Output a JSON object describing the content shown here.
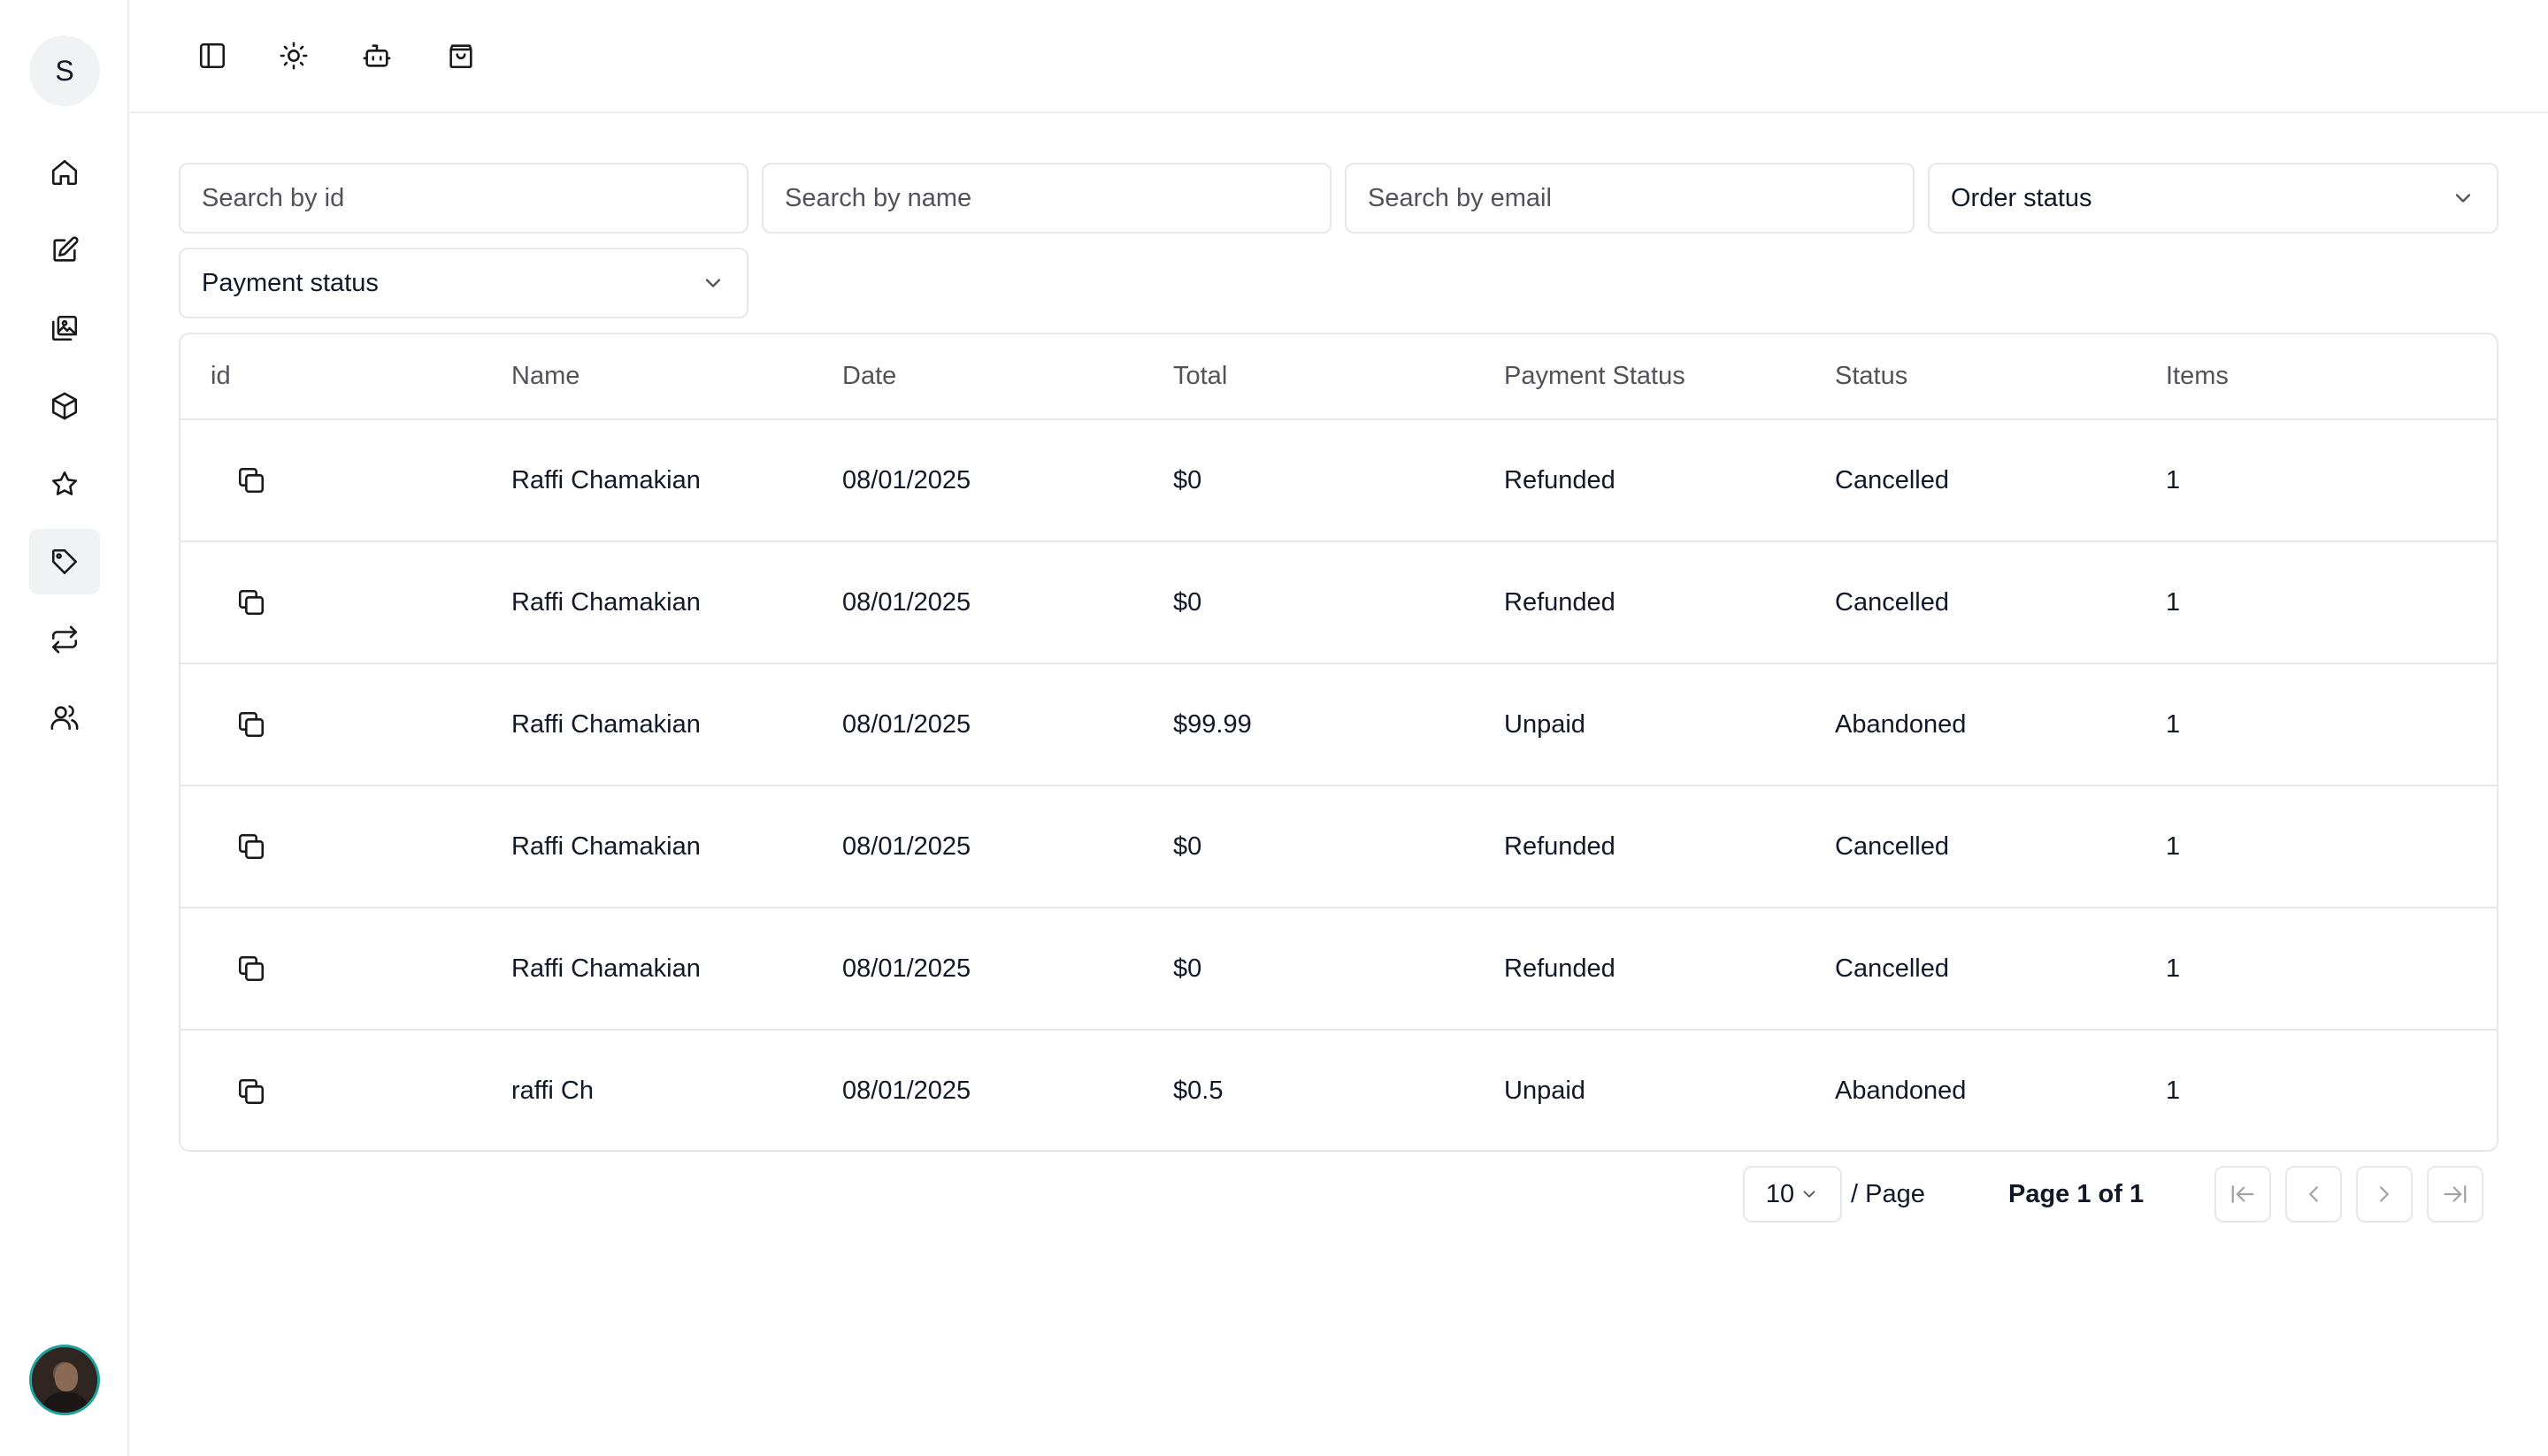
{
  "sidebar": {
    "brand_letter": "S",
    "items": [
      {
        "icon": "home-icon"
      },
      {
        "icon": "edit-icon"
      },
      {
        "icon": "gallery-icon"
      },
      {
        "icon": "box-icon"
      },
      {
        "icon": "star-icon"
      },
      {
        "icon": "tag-icon",
        "active": true
      },
      {
        "icon": "repeat-icon"
      },
      {
        "icon": "users-icon"
      }
    ]
  },
  "topbar": {
    "icons": [
      "sidebar-toggle-icon",
      "sun-icon",
      "bot-icon",
      "shopping-bag-icon"
    ]
  },
  "filters": {
    "search_id_placeholder": "Search by id",
    "search_name_placeholder": "Search by name",
    "search_email_placeholder": "Search by email",
    "order_status_label": "Order status",
    "payment_status_label": "Payment status"
  },
  "table": {
    "headers": [
      "id",
      "Name",
      "Date",
      "Total",
      "Payment Status",
      "Status",
      "Items"
    ],
    "rows": [
      {
        "name": "Raffi Chamakian",
        "date": "08/01/2025",
        "total": "$0",
        "payment_status": "Refunded",
        "status": "Cancelled",
        "items": "1"
      },
      {
        "name": "Raffi Chamakian",
        "date": "08/01/2025",
        "total": "$0",
        "payment_status": "Refunded",
        "status": "Cancelled",
        "items": "1"
      },
      {
        "name": "Raffi Chamakian",
        "date": "08/01/2025",
        "total": "$99.99",
        "payment_status": "Unpaid",
        "status": "Abandoned",
        "items": "1"
      },
      {
        "name": "Raffi Chamakian",
        "date": "08/01/2025",
        "total": "$0",
        "payment_status": "Refunded",
        "status": "Cancelled",
        "items": "1"
      },
      {
        "name": "Raffi Chamakian",
        "date": "08/01/2025",
        "total": "$0",
        "payment_status": "Refunded",
        "status": "Cancelled",
        "items": "1"
      },
      {
        "name": "raffi Ch",
        "date": "08/01/2025",
        "total": "$0.5",
        "payment_status": "Unpaid",
        "status": "Abandoned",
        "items": "1"
      }
    ]
  },
  "pagination": {
    "page_size": "10",
    "per_page_label": "/ Page",
    "page_info": "Page 1 of 1"
  }
}
